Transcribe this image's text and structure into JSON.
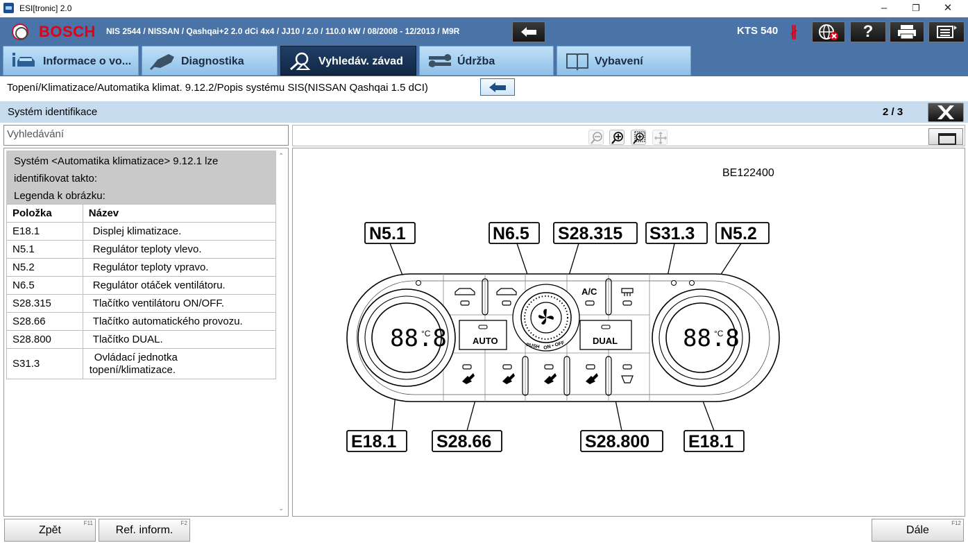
{
  "window": {
    "title": "ESI[tronic] 2.0",
    "minimize": "–",
    "restore": "❐",
    "close": "✕"
  },
  "header": {
    "brand": "BOSCH",
    "vehicle": "NIS 2544 / NISSAN / Qashqai+2 2.0 dCi 4x4 / JJ10 / 2.0 / 110.0 kW / 08/2008 - 12/2013 / M9R",
    "device": "KTS 540",
    "bluetooth_glyph": "∦",
    "help_label": "?",
    "icons": [
      "back-arrow-icon",
      "bluetooth-icon",
      "globe-offline-icon",
      "help-icon",
      "print-icon",
      "menu-icon"
    ]
  },
  "tabs": [
    {
      "label": "Informace o vo...",
      "icon": "vehicle-info-icon",
      "active": false
    },
    {
      "label": "Diagnostika",
      "icon": "diagnostics-plug-icon",
      "active": false
    },
    {
      "label": "Vyhledáv. závad",
      "icon": "fault-search-icon",
      "active": true
    },
    {
      "label": "Údržba",
      "icon": "maintenance-icon",
      "active": false
    },
    {
      "label": "Vybavení",
      "icon": "equipment-book-icon",
      "active": false
    }
  ],
  "breadcrumb": {
    "text": "Topení/Klimatizace/Automatika klimat. 9.12.2/Popis systému SIS(NISSAN Qashqai 1.5 dCI)"
  },
  "section": {
    "title": "Systém identifikace",
    "page": "2 / 3"
  },
  "search": {
    "placeholder": "Vyhledávání"
  },
  "legend": {
    "intro1": "Systém <Automatika klimatizace> 9.12.1 lze",
    "intro2": "identifikovat takto:",
    "intro3": "Legenda k obrázku:",
    "col1": "Položka",
    "col2": "Název",
    "rows": [
      {
        "item": "E18.1",
        "name": "Displej klimatizace."
      },
      {
        "item": "N5.1",
        "name": "Regulátor teploty vlevo."
      },
      {
        "item": "N5.2",
        "name": "Regulátor teploty vpravo."
      },
      {
        "item": "N6.5",
        "name": "Regulátor otáček ventilátoru."
      },
      {
        "item": "S28.315",
        "name": "Tlačítko ventilátoru ON/OFF."
      },
      {
        "item": "S28.66",
        "name": "Tlačítko automatického provozu."
      },
      {
        "item": "S28.800",
        "name": "Tlačítko DUAL."
      },
      {
        "item": "S31.3",
        "name": "Ovládací jednotka",
        "name2": "topení/klimatizace."
      }
    ]
  },
  "figure": {
    "id": "BE122400",
    "labels": {
      "n51": "N5.1",
      "n65": "N6.5",
      "s28315": "S28.315",
      "s313": "S31.3",
      "n52": "N5.2",
      "e181a": "E18.1",
      "s2866": "S28.66",
      "s28800": "S28.800",
      "e181b": "E18.1"
    },
    "panel_text": {
      "auto": "AUTO",
      "dual": "DUAL",
      "ac": "A/C",
      "push": "PUSH",
      "onoff": "ON • OFF",
      "display": "88.8",
      "unit": "°C"
    }
  },
  "footer": {
    "back": {
      "label": "Zpět",
      "key": "F11"
    },
    "ref": {
      "label": "Ref. inform.",
      "key": "F2"
    },
    "next": {
      "label": "Dále",
      "key": "F12"
    }
  }
}
